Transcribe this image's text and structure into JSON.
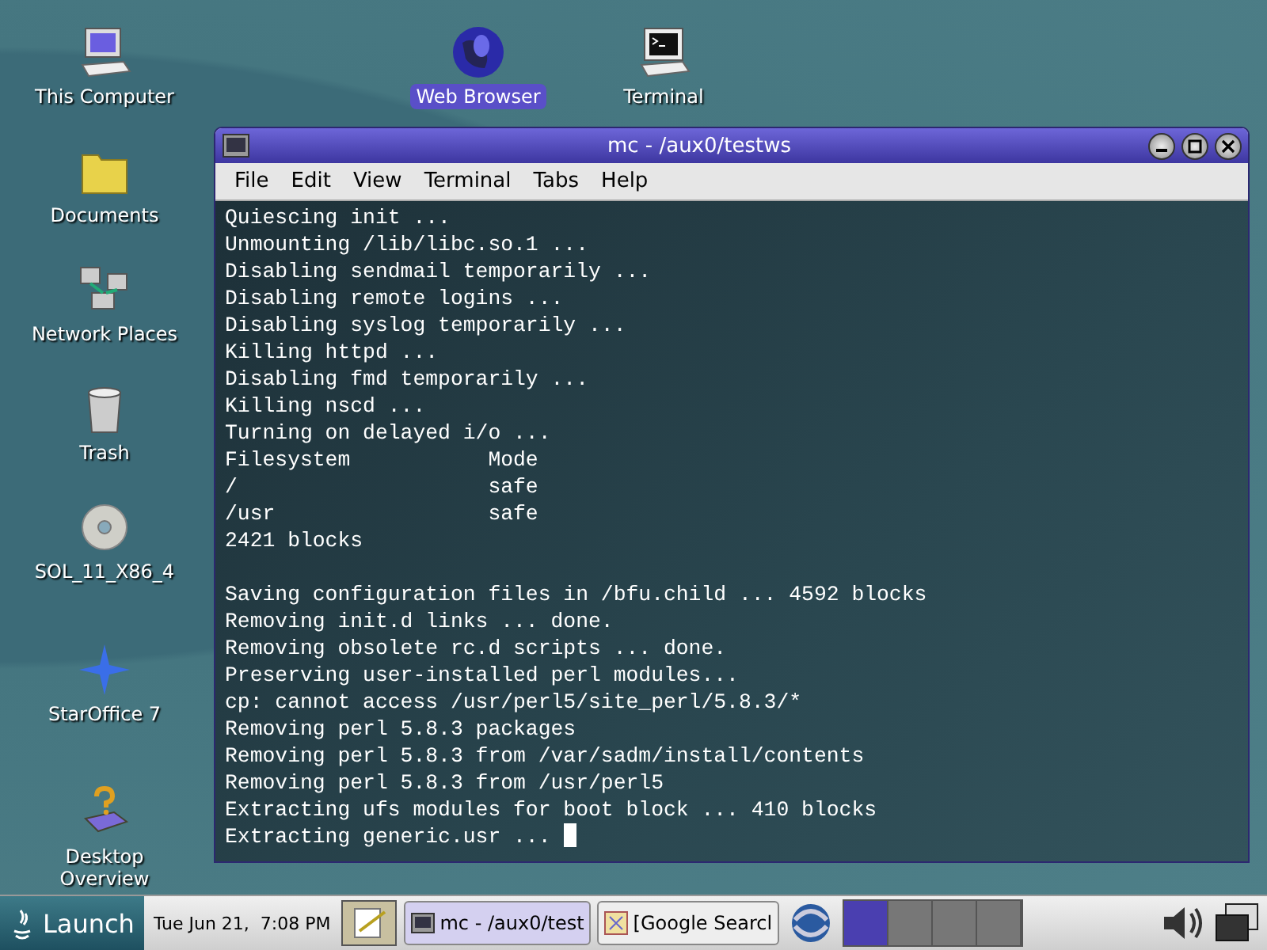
{
  "desktop_icons": [
    {
      "kind": "computer",
      "label": "This Computer",
      "selected": false
    },
    {
      "kind": "folder",
      "label": "Documents",
      "selected": false
    },
    {
      "kind": "network",
      "label": "Network Places",
      "selected": false
    },
    {
      "kind": "trash",
      "label": "Trash",
      "selected": false
    },
    {
      "kind": "disc",
      "label": "SOL_11_X86_4",
      "selected": false
    },
    {
      "kind": "star",
      "label": "StarOffice 7",
      "selected": false
    },
    {
      "kind": "help",
      "label": "Desktop Overview",
      "selected": false
    }
  ],
  "top_icons": [
    {
      "kind": "globe",
      "label": "Web Browser",
      "selected": true
    },
    {
      "kind": "terminal",
      "label": "Terminal",
      "selected": false
    }
  ],
  "window": {
    "title": "mc - /aux0/testws",
    "menu": [
      "File",
      "Edit",
      "View",
      "Terminal",
      "Tabs",
      "Help"
    ],
    "blocks": [
      [
        "Quiescing init ...",
        "Unmounting /lib/libc.so.1 ...",
        "Disabling sendmail temporarily ...",
        "Disabling remote logins ...",
        "Disabling syslog temporarily ...",
        "Killing httpd ...",
        "Disabling fmd temporarily ...",
        "Killing nscd ...",
        "Turning on delayed i/o ...",
        "Filesystem           Mode",
        "/                    safe",
        "/usr                 safe",
        "2421 blocks"
      ],
      [
        "Saving configuration files in /bfu.child ... 4592 blocks",
        "Removing init.d links ... done.",
        "Removing obsolete rc.d scripts ... done.",
        "Preserving user-installed perl modules...",
        "cp: cannot access /usr/perl5/site_perl/5.8.3/*",
        "Removing perl 5.8.3 packages",
        "Removing perl 5.8.3 from /var/sadm/install/contents",
        "Removing perl 5.8.3 from /usr/perl5",
        "Extracting ufs modules for boot block ... 410 blocks",
        "Extracting generic.usr ... "
      ]
    ]
  },
  "taskbar": {
    "launch": "Launch",
    "clock": "Tue Jun 21,  7:08 PM",
    "tasks": [
      {
        "kind": "terminal",
        "label": "mc - /aux0/test",
        "selected": true
      },
      {
        "kind": "web",
        "label": "[Google Searcl",
        "selected": false
      }
    ],
    "workspaces": [
      {
        "selected": true
      },
      {
        "selected": false
      },
      {
        "selected": false
      },
      {
        "selected": false
      }
    ]
  }
}
